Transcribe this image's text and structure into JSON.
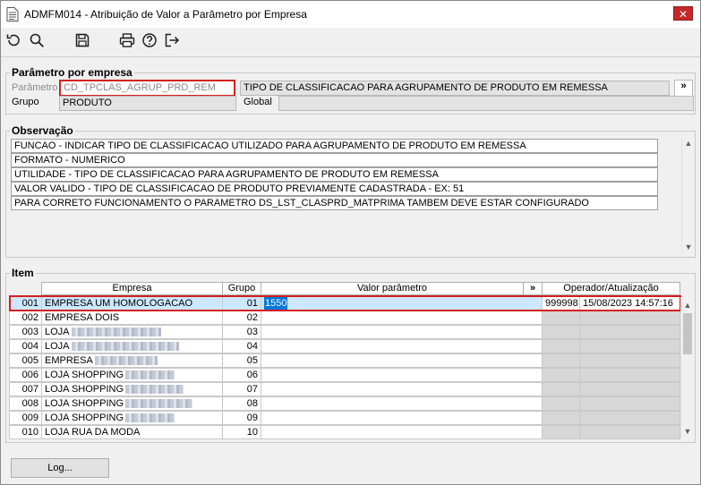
{
  "window": {
    "title": "ADMFM014 - Atribuição de Valor a Parâmetro por Empresa",
    "close_label": "✕"
  },
  "toolbar": {
    "icons": [
      "undo-icon",
      "search-icon",
      "save-icon",
      "print-icon",
      "help-icon",
      "exit-icon"
    ]
  },
  "parametro": {
    "legend": "Parâmetro por empresa",
    "param_label": "Parâmetro",
    "param_value": "CD_TPCLAS_AGRUP_PRD_REM",
    "param_description": "TIPO DE CLASSIFICACAO PARA AGRUPAMENTO DE PRODUTO EM REMESSA",
    "expand_label": "»",
    "grupo_label": "Grupo",
    "grupo_value": "PRODUTO",
    "global_label": "Global",
    "global_value": ""
  },
  "observacao": {
    "legend": "Observação",
    "lines": [
      "FUNCAO - INDICAR TIPO DE CLASSIFICACAO UTILIZADO PARA AGRUPAMENTO DE PRODUTO EM REMESSA",
      "FORMATO - NUMERICO",
      "UTILIDADE -  TIPO DE CLASSIFICACAO PARA AGRUPAMENTO DE PRODUTO EM REMESSA",
      "VALOR VALIDO - TIPO DE CLASSIFICACAO DE PRODUTO PREVIAMENTE CADASTRADA - EX: 51",
      "PARA CORRETO FUNCIONAMENTO O PARAMETRO DS_LST_CLASPRD_MATPRIMA TAMBEM DEVE ESTAR CONFIGURADO"
    ]
  },
  "item": {
    "legend": "Item",
    "headers": {
      "empresa": "Empresa",
      "grupo": "Grupo",
      "valor": "Valor parâmetro",
      "expand": "»",
      "operador": "Operador/Atualização"
    },
    "rows": [
      {
        "code": "001",
        "name": "EMPRESA UM HOMOLOGACAO",
        "grupo": "01",
        "valor": "1550",
        "operador": "999998",
        "data": "15/08/2023 14:57:16"
      },
      {
        "code": "002",
        "name": "EMPRESA DOIS",
        "grupo": "02",
        "valor": "",
        "operador": "",
        "data": ""
      },
      {
        "code": "003",
        "name": "LOJA",
        "grupo": "03",
        "valor": "",
        "operador": "",
        "data": ""
      },
      {
        "code": "004",
        "name": "LOJA",
        "grupo": "04",
        "valor": "",
        "operador": "",
        "data": ""
      },
      {
        "code": "005",
        "name": "EMPRESA",
        "grupo": "05",
        "valor": "",
        "operador": "",
        "data": ""
      },
      {
        "code": "006",
        "name": "LOJA SHOPPING",
        "grupo": "06",
        "valor": "",
        "operador": "",
        "data": ""
      },
      {
        "code": "007",
        "name": "LOJA SHOPPING",
        "grupo": "07",
        "valor": "",
        "operador": "",
        "data": ""
      },
      {
        "code": "008",
        "name": "LOJA SHOPPING",
        "grupo": "08",
        "valor": "",
        "operador": "",
        "data": ""
      },
      {
        "code": "009",
        "name": "LOJA SHOPPING",
        "grupo": "09",
        "valor": "",
        "operador": "",
        "data": ""
      },
      {
        "code": "010",
        "name": "LOJA RUA DA MODA",
        "grupo": "10",
        "valor": "",
        "operador": "",
        "data": ""
      }
    ]
  },
  "footer": {
    "log_label": "Log..."
  },
  "colors": {
    "highlight": "#d61f1f",
    "selection": "#cce8ff",
    "input_selection": "#0078d7"
  }
}
